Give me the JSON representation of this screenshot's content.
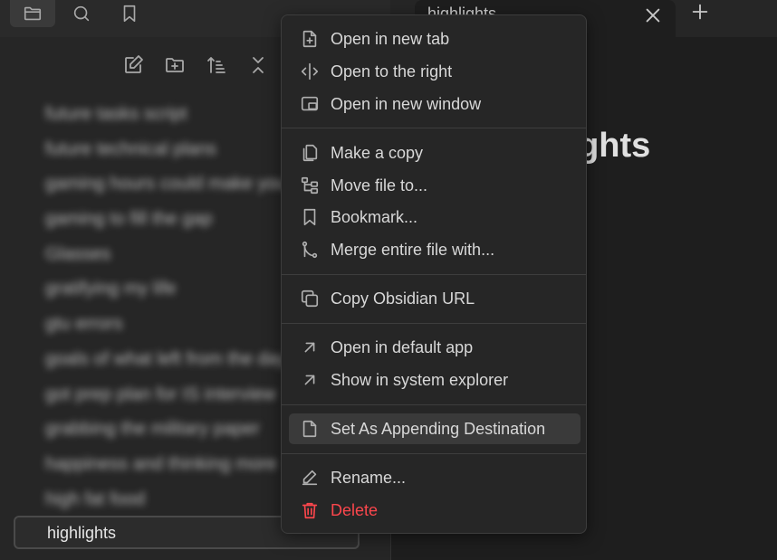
{
  "sidebar": {
    "files": [
      "future tasks script",
      "future technical plans",
      "gaming hours could make you",
      "gaming to fill the gap",
      "Glasses",
      "gratifying my life",
      "gtu errors",
      "goals of what left from the day",
      "got prep plan for IS interview",
      "grabbing the military paper",
      "happiness and thinking more",
      "high fat food"
    ],
    "selected_file": "highlights"
  },
  "tab": {
    "title": "highlights"
  },
  "document": {
    "title_fragment": "ighlights"
  },
  "menu": {
    "open_new_tab": "Open in new tab",
    "open_right": "Open to the right",
    "open_new_window": "Open in new window",
    "make_copy": "Make a copy",
    "move_file": "Move file to...",
    "bookmark": "Bookmark...",
    "merge": "Merge entire file with...",
    "copy_url": "Copy Obsidian URL",
    "open_default": "Open in default app",
    "show_explorer": "Show in system explorer",
    "set_appending": "Set As Appending Destination",
    "rename": "Rename...",
    "delete": "Delete"
  },
  "colors": {
    "danger": "#fb464c",
    "background": "#1e1e1e",
    "menu": "#262626"
  }
}
